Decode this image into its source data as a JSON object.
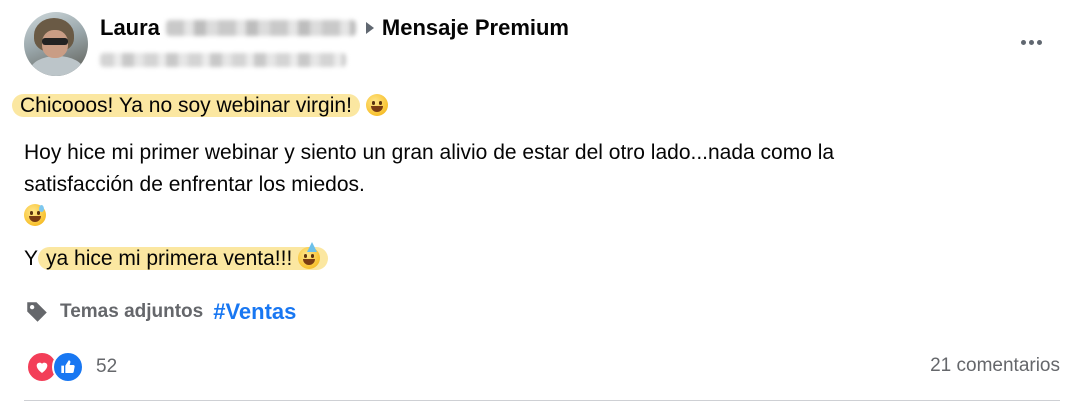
{
  "post": {
    "author_first_name": "Laura",
    "group_name": "Mensaje Premium",
    "line1": "Chicooos! Ya no soy webinar virgin!",
    "line2": "Hoy hice mi primer webinar y siento un gran alivio de estar del otro lado...nada como la",
    "line3": "satisfacción de enfrentar los miedos.",
    "line5_prefix": "Y",
    "line5": "ya hice mi primera venta!!!"
  },
  "tags": {
    "label": "Temas adjuntos",
    "hashtag": "#Ventas"
  },
  "footer": {
    "reaction_count": "52",
    "comments": "21 comentarios"
  },
  "icons": {
    "tag": "tag-icon",
    "love": "love-reaction-icon",
    "like": "like-reaction-icon",
    "more": "more-options-icon"
  }
}
